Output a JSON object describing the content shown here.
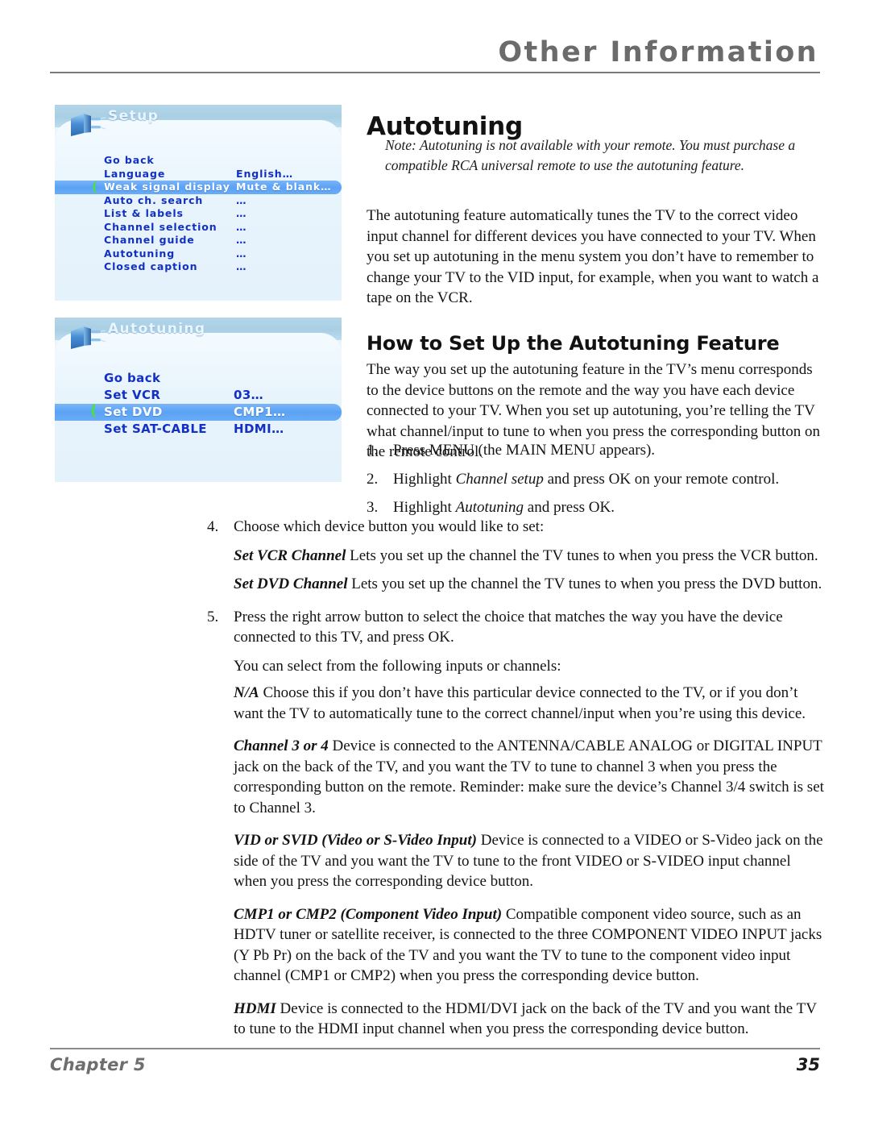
{
  "header": {
    "title": "Other Information"
  },
  "main_heading": "Autotuning",
  "note": "Note: Autotuning is not available with your remote. You must purchase a compatible RCA universal remote to use the autotuning feature.",
  "intro_paragraph": "The autotuning feature automatically tunes the TV to the correct video input channel for different devices you have connected to your TV. When you set up autotuning in the menu system you don’t have to remember to change your TV to the VID input, for example, when you want to watch a tape on the VCR.",
  "section_heading": "How to Set Up the Autotuning Feature",
  "howto_paragraph": "The way you set up the autotuning feature in the TV’s menu corresponds to the device buttons on the remote and the way you have each device connected to your TV. When you set up autotuning, you’re telling the TV what channel/input to tune to when you press the corresponding button on the remote control.",
  "steps": {
    "s1_num": "1.",
    "s1_text": "Press MENU (the MAIN MENU appears).",
    "s2_num": "2.",
    "s2_a": "Highlight ",
    "s2_em": "Channel setup",
    "s2_b": " and press OK on your remote control.",
    "s3_num": "3.",
    "s3_a": "Highlight ",
    "s3_em": "Autotuning",
    "s3_b": " and press OK.",
    "s4_num": "4.",
    "s4_text": "Choose which device button you would like to set:",
    "s5_num": "5.",
    "s5_text": "Press the right arrow button to select the choice that matches the way you have the device connected to this TV, and press OK."
  },
  "definitions": {
    "vcr_term": "Set VCR Channel",
    "vcr_text": "  Lets you set up the channel the TV tunes to when you press the VCR button.",
    "dvd_term": "Set DVD Channel",
    "dvd_text": "  Lets you set up the channel the TV tunes to when you press the DVD button.",
    "inputs_lead": "You can select from the following inputs or channels:",
    "na_term": "N/A",
    "na_text": "  Choose this if you don’t have this particular device connected to the TV, or if you don’t want the TV to automatically tune to the correct channel/input when you’re using this device.",
    "ch34_term": "Channel 3 or 4",
    "ch34_text": "  Device is connected to the ANTENNA/CABLE ANALOG or DIGITAL INPUT jack on the back of the TV, and you want the TV to tune to channel 3 when you press the corresponding button on the remote. Reminder: make sure the device’s Channel 3/4 switch is set to Channel 3.",
    "vid_term": "VID or SVID (Video or S-Video Input)",
    "vid_text": "   Device is connected to a VIDEO or S-Video jack on the side of the TV and you want the TV to tune to the front VIDEO or S-VIDEO input channel when you press the corresponding device button.",
    "cmp_term": "CMP1 or CMP2 (Component Video Input)",
    "cmp_text": "   Compatible component video source, such as an HDTV tuner or satellite receiver, is connected to the three COMPONENT VIDEO INPUT jacks (Y Pb Pr) on the back of the TV and you want the TV to tune to the component video input channel (CMP1 or CMP2) when you press the corresponding device button.",
    "hdmi_term": "HDMI",
    "hdmi_text": "   Device is connected to the HDMI/DVI jack on the back of the TV and you want the TV to tune to the HDMI input channel when you press the corresponding device button."
  },
  "osd_setup": {
    "title": "Setup",
    "icon": "plug-icon",
    "rows": [
      {
        "label": "Go back",
        "value": "",
        "highlighted": false
      },
      {
        "label": "Language",
        "value": "English…",
        "highlighted": false
      },
      {
        "label": "Weak signal display",
        "value": "Mute & blank…",
        "highlighted": true
      },
      {
        "label": "Auto ch. search",
        "value": "…",
        "highlighted": false
      },
      {
        "label": "List & labels",
        "value": "…",
        "highlighted": false
      },
      {
        "label": "Channel selection",
        "value": "…",
        "highlighted": false
      },
      {
        "label": "Channel guide",
        "value": "…",
        "highlighted": false
      },
      {
        "label": "Autotuning",
        "value": "…",
        "highlighted": false
      },
      {
        "label": "Closed caption",
        "value": "…",
        "highlighted": false
      }
    ]
  },
  "osd_autotuning": {
    "title": "Autotuning",
    "icon": "plug-icon",
    "rows": [
      {
        "label": "Go back",
        "value": "",
        "highlighted": false
      },
      {
        "label": "Set VCR",
        "value": "03…",
        "highlighted": false
      },
      {
        "label": "Set DVD",
        "value": "CMP1…",
        "highlighted": true
      },
      {
        "label": "Set SAT-CABLE",
        "value": "HDMI…",
        "highlighted": false
      }
    ]
  },
  "footer": {
    "chapter": "Chapter 5",
    "page": "35"
  },
  "colors": {
    "osd_text": "#1330c4",
    "osd_highlight": "#5ba2f5",
    "osd_panel_bg": "#eaf4fb",
    "osd_header_bg": "#b3d5e8",
    "caret_green": "#49e43a",
    "header_gray": "#6b6b6b"
  }
}
